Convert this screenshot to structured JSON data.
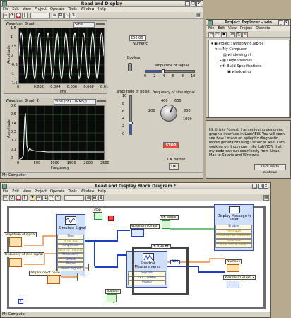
{
  "front_panel": {
    "title": "Read and Display",
    "menu": [
      "File",
      "Edit",
      "View",
      "Project",
      "Operate",
      "Tools",
      "Window",
      "Help"
    ],
    "graph1": {
      "label": "Waveform Graph",
      "legend": "Sine",
      "ylabel": "Amplitude",
      "xlabel": "Time",
      "yticks": [
        "1.5",
        "1",
        "0.5",
        "0",
        "-0.5",
        "-1",
        "-1.5"
      ],
      "xticks": [
        "0",
        "0.002",
        "0.004",
        "0.006",
        "0.008",
        "0.01"
      ]
    },
    "numeric": {
      "value": "200.00",
      "label": "Numeric"
    },
    "boolean_label": "Boolean",
    "amplitude_signal": {
      "label": "amplitude of signal",
      "ticks": [
        "0",
        "2",
        "4",
        "6",
        "8",
        "10"
      ]
    },
    "amplitude_noise": {
      "label": "amplitude of noise",
      "ticks": [
        "10",
        "8",
        "6",
        "4",
        "2",
        "0"
      ]
    },
    "frequency_knob": {
      "label": "frequency of sine signal",
      "ticks": [
        "200",
        "400",
        "600",
        "800",
        "1000"
      ]
    },
    "graph2": {
      "label": "Waveform Graph 2",
      "legend": "Sine (FFT - (RMS))",
      "ylabel": "Amplitude",
      "xlabel": "Frequency",
      "yticks": [
        "0.6",
        "0.5",
        "0.4",
        "0.3",
        "0.2",
        "0.1",
        "0"
      ],
      "xticks": [
        "0",
        "500",
        "1000",
        "1500",
        "2000",
        "2500"
      ]
    },
    "stop_label": "STOP",
    "ok_button": {
      "label": "OK Button",
      "text": "OK"
    },
    "status": "My Computer"
  },
  "project_explorer": {
    "title": "Project Explorer - win",
    "menu": [
      "File",
      "Edit",
      "View",
      "Project",
      "Operate"
    ],
    "tree": [
      "Project: windowing.lvproj",
      "My Computer",
      "windowing.vi",
      "Dependencies",
      "Build Specifications",
      "windowing"
    ]
  },
  "dialog": {
    "message": "Hi, this is Forrest.  I am enjoying designing graphic interface in LabVIEW. You will soon see how I made an epileptic diagnostic report generator using LabVIEW. And, I am working on linux now.  I like LabVIEW that my code can run seamlessly from Linux, Mac to Solaris and Windows.",
    "button": "Click me to continue"
  },
  "block_diagram": {
    "title": "Read and Display Block Diagram *",
    "menu": [
      "File",
      "Edit",
      "View",
      "Project",
      "Operate",
      "Tools",
      "Window",
      "Help"
    ],
    "simulate": {
      "title": "Simulate Signal",
      "rows": [
        "Sine",
        "error out",
        "Amplitude",
        "error in (no error)",
        "Frequency",
        "Offset",
        "Phase",
        "Reset Signal"
      ]
    },
    "spectral": {
      "title": "Spectral Measurements",
      "rows": [
        "Signals",
        "FFT - (RMS)",
        "Phase"
      ]
    },
    "display_msg": {
      "title": "Display Message to User",
      "rows": [
        "Enable",
        "Message",
        "Click me to continue",
        "error out",
        "error in (no error)"
      ]
    },
    "case_selector": "True",
    "constant": "100",
    "terminals": {
      "amp_signal": "amplitude of signal",
      "freq_sine": "frequency of sine signal",
      "amp_noise": "amplitude of noise",
      "stop": "stop",
      "waveform_graph": "Waveform Graph",
      "ok_button": "OK Button",
      "numeric": "Numeric",
      "waveform_graph2": "Waveform Graph 2",
      "boolean": "Boolean"
    },
    "status": "My Computer"
  },
  "colors": {
    "desktop": "#b7aa8e",
    "plot_bg": "#0b0b0b",
    "wave": "#ffffff",
    "grid": "#2e6f2e",
    "wire_orange": "#e8781c",
    "wire_blue": "#1f3fbf"
  }
}
